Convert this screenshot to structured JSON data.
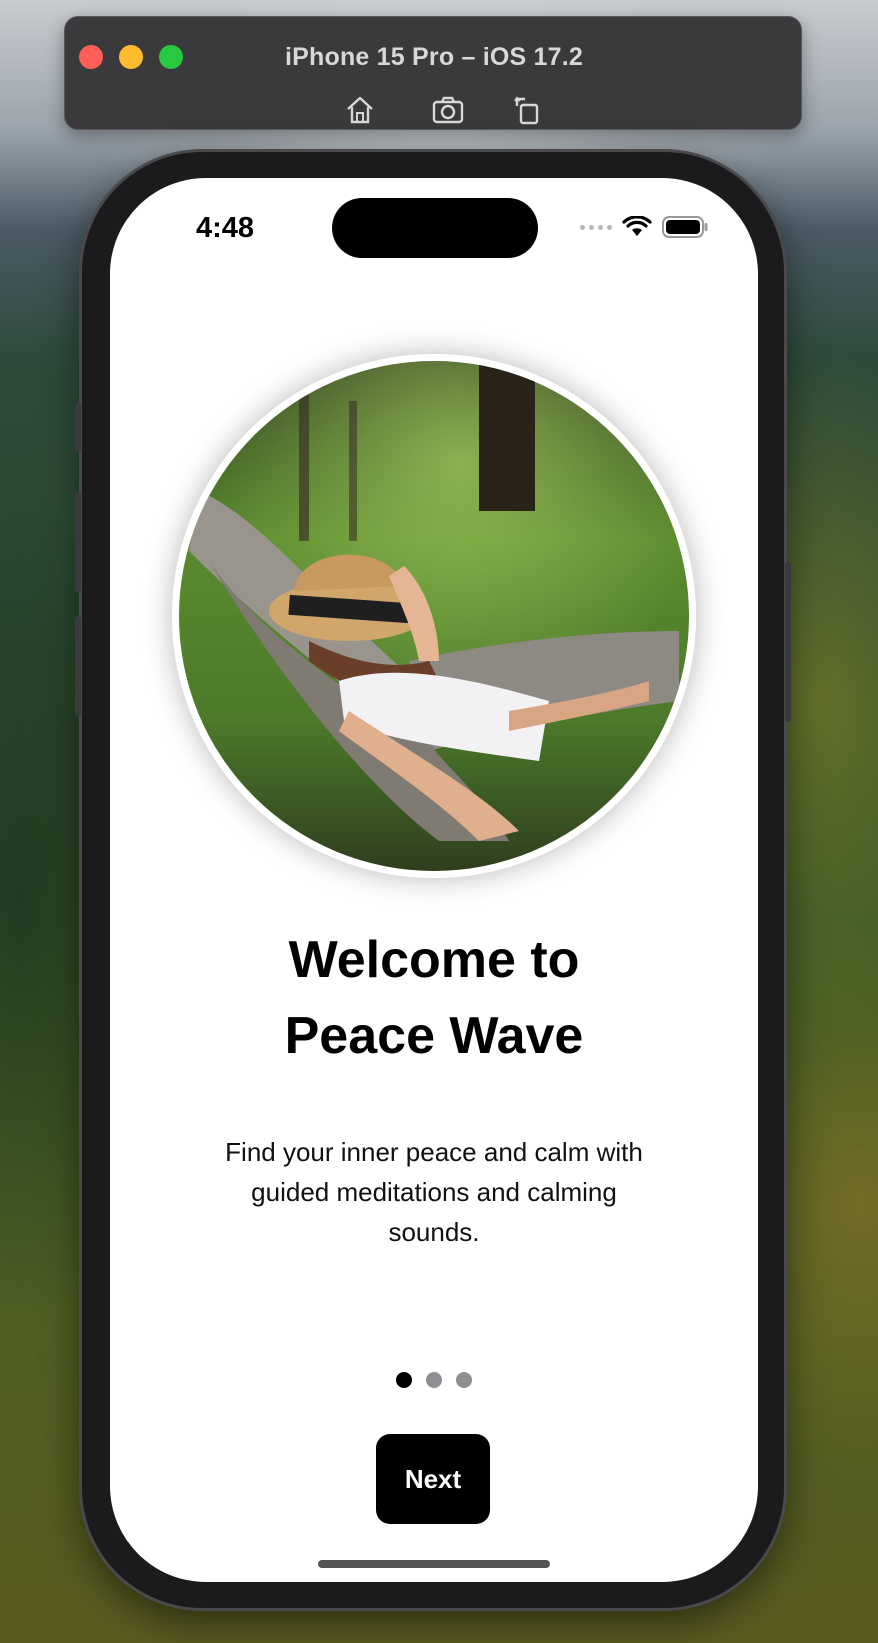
{
  "simulator": {
    "title": "iPhone 15 Pro – iOS 17.2",
    "toolbar_icons": [
      "home-icon",
      "screenshot-icon",
      "rotate-icon"
    ]
  },
  "status_bar": {
    "time": "4:48",
    "icons": [
      "cellular-signal-icon",
      "wifi-icon",
      "battery-icon"
    ]
  },
  "onboarding": {
    "title_line1": "Welcome to",
    "title_line2": "Peace Wave",
    "description": "Find your inner peace and calm with guided meditations and calming sounds.",
    "page_count": 3,
    "current_page": 1,
    "next_label": "Next"
  },
  "colors": {
    "button_bg": "#000000",
    "button_text": "#ffffff",
    "dot_active": "#000000",
    "dot_inactive": "#8e8e93"
  }
}
